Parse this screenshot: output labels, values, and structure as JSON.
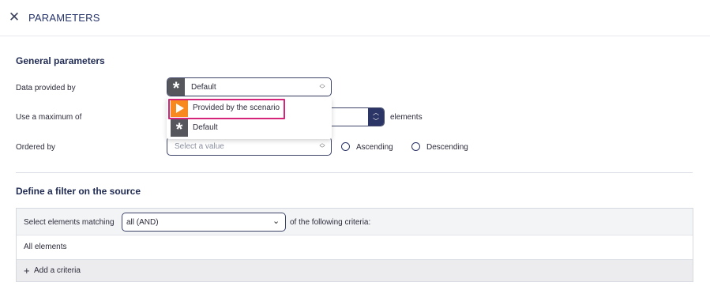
{
  "header": {
    "title": "PARAMETERS",
    "close_icon": "close-icon"
  },
  "general": {
    "title": "General parameters",
    "data_provided_by": {
      "label": "Data provided by",
      "selected": "Default",
      "selected_icon": "asterisk-icon",
      "options": [
        {
          "label": "Provided by the scenario",
          "icon": "play-icon",
          "highlighted": true
        },
        {
          "label": "Default",
          "icon": "asterisk-icon",
          "highlighted": false
        }
      ]
    },
    "maximum": {
      "label": "Use a maximum of",
      "suffix": "elements"
    },
    "ordered_by": {
      "label": "Ordered by",
      "placeholder": "Select a value",
      "ascending": "Ascending",
      "descending": "Descending"
    }
  },
  "filter": {
    "title": "Define a filter on the source",
    "prefix": "Select elements matching",
    "match_value": "all (AND)",
    "suffix": "of the following criteria:",
    "all_elements": "All elements",
    "add_label": "Add a criteria"
  },
  "colors": {
    "accent": "#2b3566",
    "highlight_border": "#d6247a",
    "play_orange": "#f7891f",
    "asterisk_gray": "#55575c"
  }
}
